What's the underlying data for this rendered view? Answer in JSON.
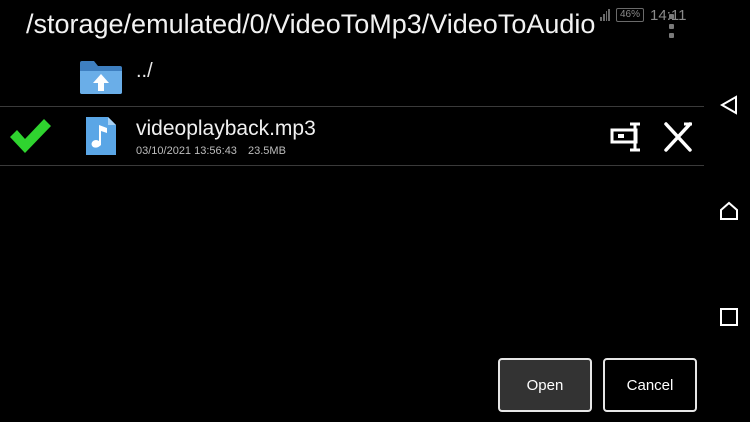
{
  "status": {
    "battery": "46%",
    "time": "14:11"
  },
  "header": {
    "path": "/storage/emulated/0/VideoToMp3/VideoToAudio"
  },
  "parent_entry": {
    "label": "../",
    "icon": "folder-up-icon"
  },
  "files": [
    {
      "name": "videoplayback.mp3",
      "date": "03/10/2021 13:56:43",
      "size": "23.5MB",
      "selected": true,
      "icon": "music-file-icon"
    }
  ],
  "buttons": {
    "open": "Open",
    "cancel": "Cancel"
  },
  "colors": {
    "check": "#2fd42f",
    "folder": "#4a8ac8",
    "file_icon": "#5aa6e6"
  }
}
